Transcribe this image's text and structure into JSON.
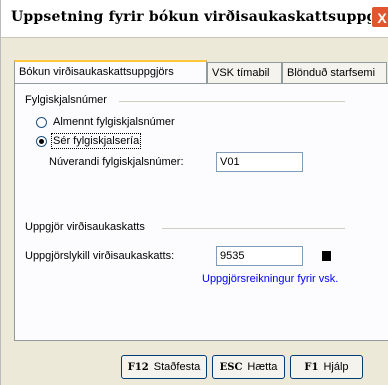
{
  "window": {
    "title": "Uppsetning fyrir bókun virðisaukaskattsuppgjörs",
    "close_label": "X"
  },
  "tabs": [
    {
      "label": "Bókun virðisaukaskattsuppgjörs",
      "active": true
    },
    {
      "label": "VSK tímabil",
      "active": false
    },
    {
      "label": "Blönduð starfsemi",
      "active": false
    }
  ],
  "fylgiskjal": {
    "group_title": "Fylgiskjalsnúmer",
    "radio_general": "Almennt fylgiskjalsnúmer",
    "radio_special": "Sér fylgiskjalsería",
    "selected": "special",
    "current_label": "Núverandi fylgiskjalsnúmer:",
    "current_value": "V01"
  },
  "uppgjor": {
    "group_title": "Uppgjör virðisaukaskatts",
    "key_label": "Uppgjörslykill virðisaukaskatts:",
    "key_value": "9535",
    "link_text": "Uppgjörsreikningur fyrir vsk."
  },
  "footer": {
    "confirm_key": "F12",
    "confirm_label": "Staðfesta",
    "cancel_key": "ESC",
    "cancel_label": "Hætta",
    "help_key": "F1",
    "help_label": "Hjálp"
  }
}
